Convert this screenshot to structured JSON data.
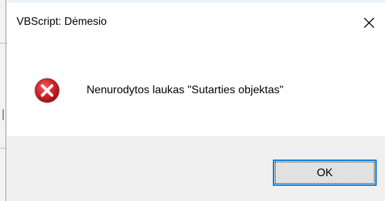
{
  "dialog": {
    "title": "VBScript: Dėmesio",
    "close_icon": "close-icon",
    "message_icon": "error-icon",
    "message": "Nenurodytos laukas \"Sutarties objektas\"",
    "ok_label": "OK",
    "colors": {
      "icon_red": "#c8202a",
      "button_focus_border": "#0078d7",
      "footer_bg": "#f0f0f0"
    }
  }
}
